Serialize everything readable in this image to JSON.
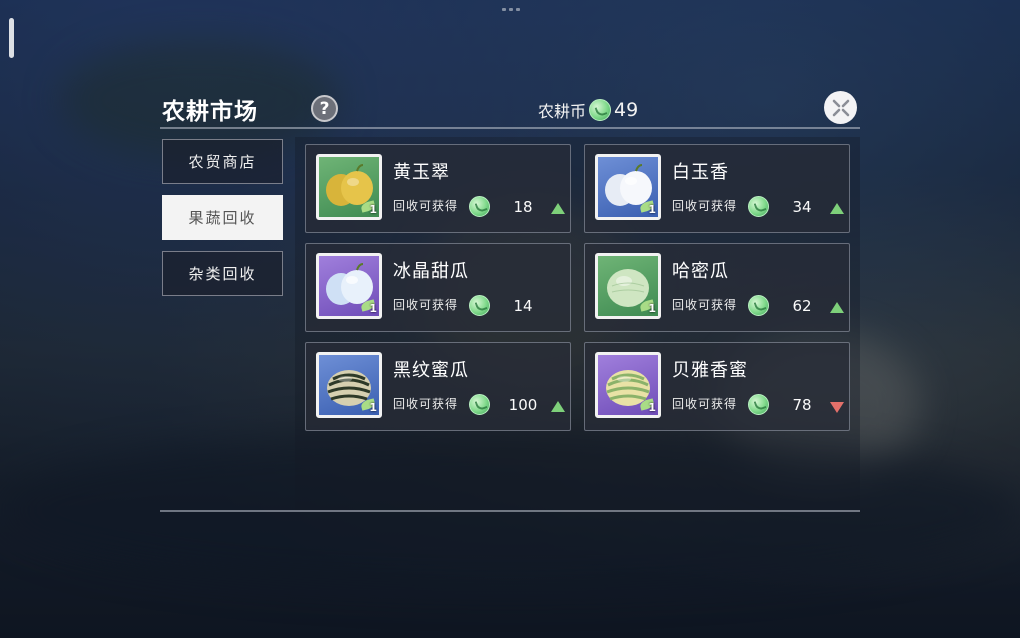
{
  "panel": {
    "title": "农耕市场",
    "help_icon": "?"
  },
  "currency": {
    "label": "农耕币",
    "amount": "49",
    "icon": "farm-coin-icon"
  },
  "tabs": [
    {
      "label": "农贸商店",
      "active": false
    },
    {
      "label": "果蔬回收",
      "active": true
    },
    {
      "label": "杂类回收",
      "active": false
    }
  ],
  "items": [
    {
      "name": "黄玉翠",
      "receive_label": "回收可获得",
      "price": "18",
      "trend": "up",
      "thumb_color": "green",
      "count": "1"
    },
    {
      "name": "白玉香",
      "receive_label": "回收可获得",
      "price": "34",
      "trend": "up",
      "thumb_color": "blue",
      "count": "1"
    },
    {
      "name": "冰晶甜瓜",
      "receive_label": "回收可获得",
      "price": "14",
      "trend": "none",
      "thumb_color": "purple",
      "count": "1"
    },
    {
      "name": "哈密瓜",
      "receive_label": "回收可获得",
      "price": "62",
      "trend": "up",
      "thumb_color": "green",
      "count": "1"
    },
    {
      "name": "黑纹蜜瓜",
      "receive_label": "回收可获得",
      "price": "100",
      "trend": "up",
      "thumb_color": "blue",
      "count": "1"
    },
    {
      "name": "贝雅香蜜",
      "receive_label": "回收可获得",
      "price": "78",
      "trend": "down",
      "thumb_color": "purple",
      "count": "1"
    }
  ],
  "colors": {
    "trend_up": "#7ed07a",
    "trend_down": "#e3706a",
    "tab_active_bg": "#f3f3f3"
  }
}
